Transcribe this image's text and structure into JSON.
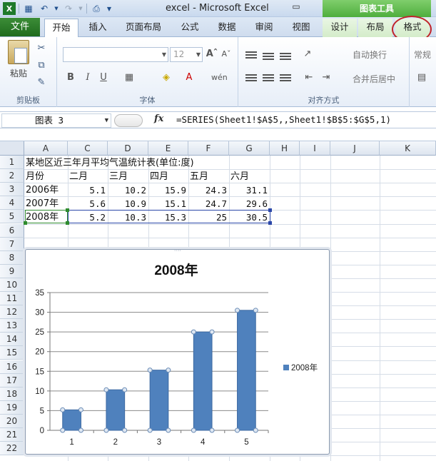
{
  "window": {
    "title": "excel  -  Microsoft Excel",
    "context_tools": "图表工具",
    "minimize": "▭"
  },
  "tabs": {
    "file": "文件",
    "items": [
      {
        "label": "开始",
        "active": true
      },
      {
        "label": "插入"
      },
      {
        "label": "页面布局"
      },
      {
        "label": "公式"
      },
      {
        "label": "数据"
      },
      {
        "label": "审阅"
      },
      {
        "label": "视图"
      },
      {
        "label": "设计",
        "context": true
      },
      {
        "label": "布局",
        "context": true
      },
      {
        "label": "格式",
        "context": true
      }
    ]
  },
  "ribbon": {
    "clipboard": {
      "paste": "粘贴",
      "label": "剪贴板"
    },
    "font": {
      "size": "12",
      "bold": "B",
      "italic": "I",
      "underline": "U",
      "label": "字体"
    },
    "alignment": {
      "wrap": "自动换行",
      "merge": "合并后居中",
      "label": "对齐方式"
    },
    "number": {
      "format": "常规"
    }
  },
  "formula_bar": {
    "name_box": "图表 3",
    "fx": "fx",
    "formula": "=SERIES(Sheet1!$A$5,,Sheet1!$B$5:$G$5,1)"
  },
  "grid": {
    "columns": [
      "A",
      "C",
      "D",
      "E",
      "F",
      "G",
      "H",
      "I",
      "J",
      "K"
    ],
    "rows": [
      "1",
      "2",
      "3",
      "4",
      "5",
      "6",
      "7",
      "8",
      "9",
      "10",
      "11",
      "12",
      "13",
      "14",
      "15",
      "16",
      "17",
      "18",
      "19",
      "20",
      "21",
      "22"
    ],
    "title_cell": "某地区近三年月平均气温统计表(单位:度)",
    "header_row": [
      "月份",
      "二月",
      "三月",
      "四月",
      "五月",
      "六月"
    ],
    "data_rows": [
      {
        "label": "2006年",
        "values": [
          "5.1",
          "10.2",
          "15.9",
          "24.3",
          "31.1"
        ]
      },
      {
        "label": "2007年",
        "values": [
          "5.6",
          "10.9",
          "15.1",
          "24.7",
          "29.6"
        ]
      },
      {
        "label": "2008年",
        "values": [
          "5.2",
          "10.3",
          "15.3",
          "25",
          "30.5"
        ]
      }
    ]
  },
  "colors": {
    "bar": "#4f81bd",
    "file_tab": "#2c7b2a",
    "context_tab": "#5cb84a",
    "highlight_circle": "#c0242a"
  },
  "chart_data": {
    "type": "bar",
    "title": "2008年",
    "categories": [
      "1",
      "2",
      "3",
      "4",
      "5"
    ],
    "series": [
      {
        "name": "2008年",
        "values": [
          5.2,
          10.3,
          15.3,
          25,
          30.5
        ]
      }
    ],
    "ylim": [
      0,
      35
    ],
    "yticks": [
      "0",
      "5",
      "10",
      "15",
      "20",
      "25",
      "30",
      "35"
    ],
    "grid": true,
    "legend": "right",
    "selected_series": true
  }
}
